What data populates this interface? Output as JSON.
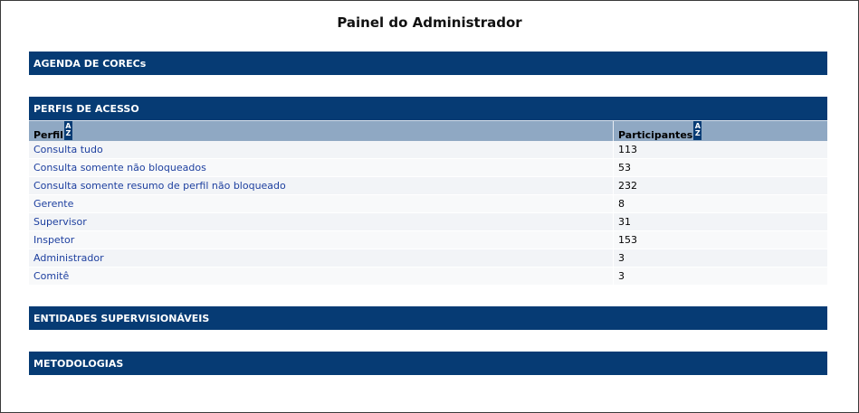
{
  "page": {
    "title": "Painel do Administrador"
  },
  "sections": {
    "agenda": "AGENDA DE CORECs",
    "perfis": "PERFIS DE ACESSO",
    "entidades": "ENTIDADES SUPERVISIONÁVEIS",
    "metodologias": "METODOLOGIAS"
  },
  "table": {
    "headers": {
      "perfil": "Perfil",
      "participantes": "Participantes"
    },
    "sort_icon": {
      "top": "A",
      "bottom": "Z"
    },
    "rows": [
      {
        "perfil": "Consulta tudo",
        "participantes": "113"
      },
      {
        "perfil": "Consulta somente não bloqueados",
        "participantes": "53"
      },
      {
        "perfil": "Consulta somente resumo de perfil não bloqueado",
        "participantes": "232"
      },
      {
        "perfil": "Gerente",
        "participantes": "8"
      },
      {
        "perfil": "Supervisor",
        "participantes": "31"
      },
      {
        "perfil": "Inspetor",
        "participantes": "153"
      },
      {
        "perfil": "Administrador",
        "participantes": "3"
      },
      {
        "perfil": "Comitê",
        "participantes": "3"
      }
    ]
  },
  "colors": {
    "section_bg": "#063b74",
    "header_bg": "#8fa8c3",
    "link": "#1d3f9f"
  }
}
